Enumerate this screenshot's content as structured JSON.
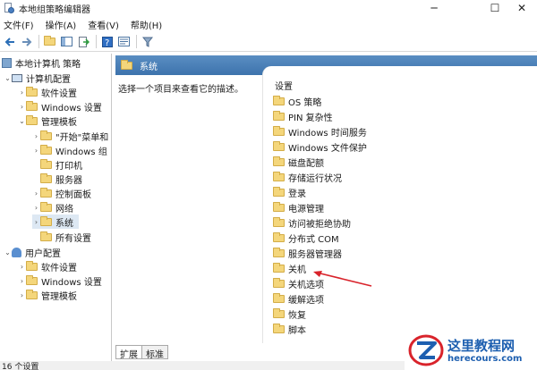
{
  "window": {
    "title": "本地组策略编辑器",
    "controls": {
      "minimize": "─",
      "maximize": "☐",
      "close": "✕"
    }
  },
  "menu": [
    "文件(F)",
    "操作(A)",
    "查看(V)",
    "帮助(H)"
  ],
  "toolbar": {
    "icons": [
      "back-arrow-icon",
      "forward-arrow-icon",
      "up-folder-icon",
      "show-hide-tree-icon",
      "export-list-icon",
      "help-icon",
      "properties-icon",
      "filter-icon"
    ]
  },
  "tree": {
    "root": "本地计算机 策略",
    "computer_config": "计算机配置",
    "software_settings": "软件设置",
    "windows_settings": "Windows 设置",
    "admin_templates": "管理模板",
    "start_menu": "\"开始\"菜单和",
    "windows_components": "Windows 组",
    "printers": "打印机",
    "server": "服务器",
    "control_panel": "控制面板",
    "network": "网络",
    "system": "系统",
    "all_settings": "所有设置",
    "user_config": "用户配置",
    "user_software_settings": "软件设置",
    "user_windows_settings": "Windows 设置",
    "user_admin_templates": "管理模板"
  },
  "header": {
    "folder_name": "系统"
  },
  "description": {
    "text": "选择一个项目来查看它的描述。"
  },
  "list": {
    "column_header": "设置",
    "items": [
      "OS 策略",
      "PIN 复杂性",
      "Windows 时间服务",
      "Windows 文件保护",
      "磁盘配额",
      "存储运行状况",
      "登录",
      "电源管理",
      "访问被拒绝协助",
      "分布式 COM",
      "服务器管理器",
      "关机",
      "关机选项",
      "缓解选项",
      "恢复",
      "脚本"
    ]
  },
  "tabs": [
    "扩展",
    "标准"
  ],
  "status": {
    "text": "16 个设置"
  },
  "watermark": {
    "title": "这里教程网",
    "url": "herecours.com"
  },
  "colors": {
    "header_blue": "#3d73ad",
    "folder_yellow": "#f4d67b",
    "annotation_red": "#d9232b",
    "selection": "#dde8f3"
  }
}
